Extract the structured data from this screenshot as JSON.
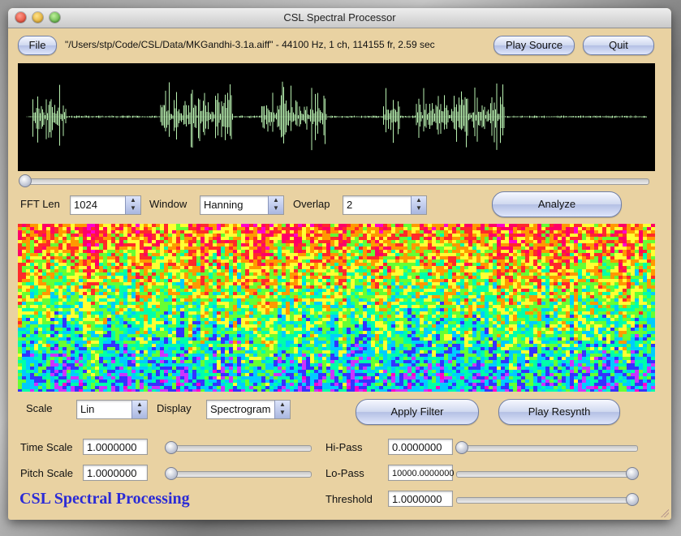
{
  "window": {
    "title": "CSL Spectral Processor"
  },
  "toolbar": {
    "file_label": "File",
    "source_info": "\"/Users/stp/Code/CSL/Data/MKGandhi-3.1a.aiff\" - 44100 Hz, 1 ch, 114155 fr,  2.59 sec",
    "play_source_label": "Play Source",
    "quit_label": "Quit"
  },
  "position_slider": {
    "value": 0.0
  },
  "analysis": {
    "fft_len_label": "FFT Len",
    "fft_len_value": "1024",
    "window_label": "Window",
    "window_value": "Hanning",
    "overlap_label": "Overlap",
    "overlap_value": "2",
    "analyze_label": "Analyze"
  },
  "display": {
    "scale_label": "Scale",
    "scale_value": "Lin",
    "display_label": "Display",
    "display_value": "Spectrogram",
    "apply_filter_label": "Apply Filter",
    "play_resynth_label": "Play Resynth"
  },
  "params": {
    "time_scale_label": "Time Scale",
    "time_scale_value": "1.0000000",
    "time_scale_slider": 0.0,
    "pitch_scale_label": "Pitch Scale",
    "pitch_scale_value": "1.0000000",
    "pitch_scale_slider": 0.0,
    "hipass_label": "Hi-Pass",
    "hipass_value": "0.0000000",
    "hipass_slider": 0.0,
    "lopass_label": "Lo-Pass",
    "lopass_value": "10000.0000000",
    "lopass_slider": 1.0,
    "threshold_label": "Threshold",
    "threshold_value": "1.0000000",
    "threshold_slider": 1.0
  },
  "brand": "CSL Spectral Processing",
  "colors": {
    "window_bg": "#e9d2a2",
    "waveform": "#b8f0b0",
    "brand_text": "#2b2bd6"
  }
}
